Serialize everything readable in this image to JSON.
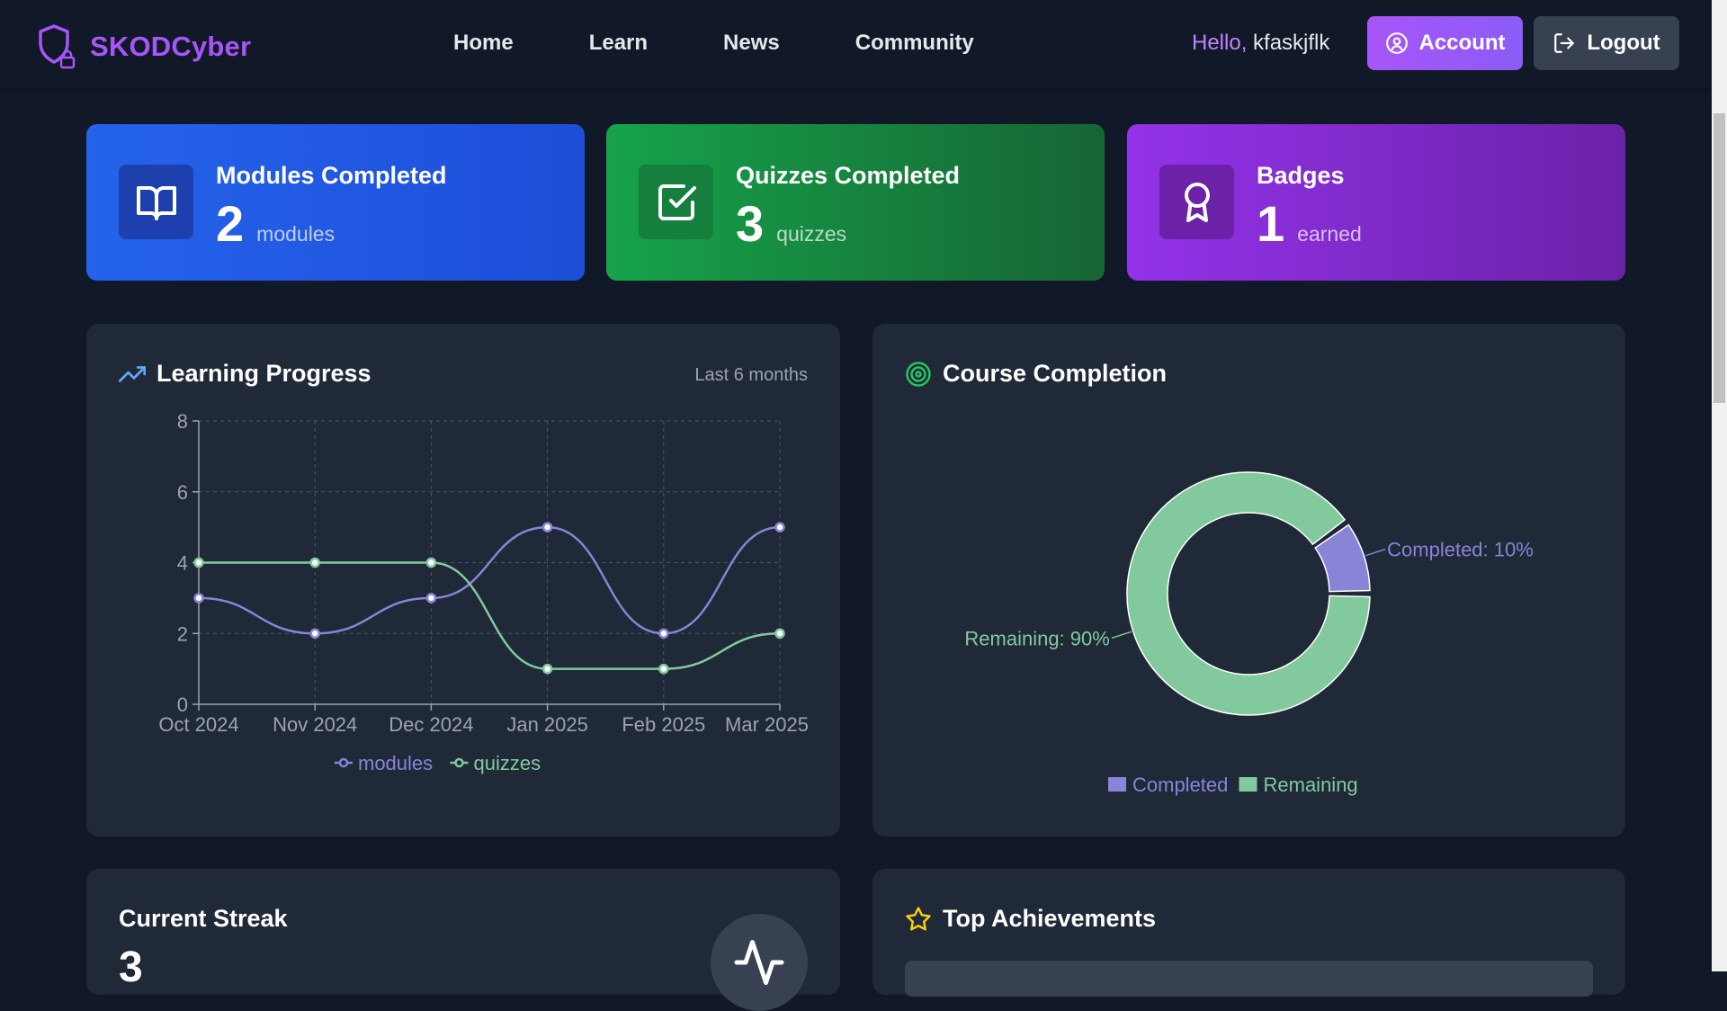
{
  "nav": {
    "brand": "SKODCyber",
    "links": [
      "Home",
      "Learn",
      "News",
      "Community"
    ],
    "greeting_hello": "Hello,",
    "username": "kfaskjflk",
    "account_label": "Account",
    "logout_label": "Logout"
  },
  "stats": [
    {
      "title": "Modules Completed",
      "value": "2",
      "unit": "modules",
      "icon": "book-icon"
    },
    {
      "title": "Quizzes Completed",
      "value": "3",
      "unit": "quizzes",
      "icon": "checkbox-icon"
    },
    {
      "title": "Badges",
      "value": "1",
      "unit": "earned",
      "icon": "award-icon"
    }
  ],
  "progress": {
    "title": "Learning Progress",
    "subtitle": "Last 6 months"
  },
  "completion": {
    "title": "Course Completion"
  },
  "streak": {
    "title": "Current Streak",
    "value": "3"
  },
  "achievements": {
    "title": "Top Achievements"
  },
  "colors": {
    "modules": "#8884d8",
    "quizzes": "#82ca9d",
    "accent": "#a855f7"
  },
  "chart_data": [
    {
      "type": "line",
      "categories": [
        "Oct 2024",
        "Nov 2024",
        "Dec 2024",
        "Jan 2025",
        "Feb 2025",
        "Mar 2025"
      ],
      "series": [
        {
          "name": "modules",
          "values": [
            3,
            2,
            3,
            5,
            2,
            5
          ]
        },
        {
          "name": "quizzes",
          "values": [
            4,
            4,
            4,
            1,
            1,
            2
          ]
        }
      ],
      "yticks": [
        0,
        2,
        4,
        6,
        8
      ],
      "ylim": [
        0,
        8
      ],
      "grid": true,
      "legend": "bottom"
    },
    {
      "type": "pie",
      "categories": [
        "Completed",
        "Remaining"
      ],
      "values": [
        10,
        90
      ],
      "labels": [
        "Completed: 10%",
        "Remaining: 90%"
      ],
      "legend": "bottom"
    }
  ]
}
